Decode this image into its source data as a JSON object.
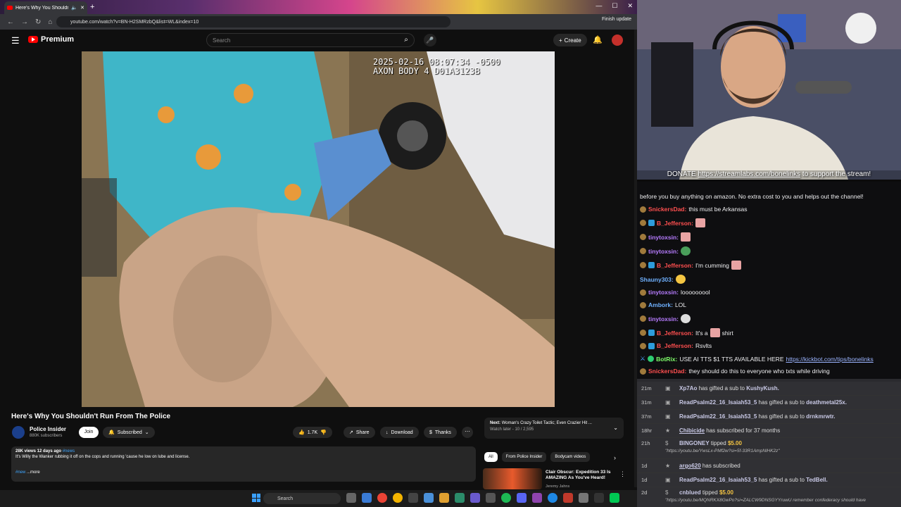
{
  "browser": {
    "tab_title": "Here's Why You Shouldn't",
    "url": "youtube.com/watch?v=BN-H2SMRzbQ&list=WL&index=10",
    "finish_update": "Finish update",
    "new_tab": "+"
  },
  "yt_header": {
    "logo_text": "Premium",
    "search_placeholder": "Search",
    "create_label": "Create"
  },
  "video": {
    "timestamp": "2025-02-16 08:07:34 -0500\nAXON BODY 4 D01A3123B"
  },
  "under_video": {
    "title": "Here's Why You Shouldn't Run From The Police",
    "channel_name": "Police Insider",
    "channel_subs": "880K subscribers",
    "join_label": "Join",
    "subscribed_label": "Subscribed",
    "like_count": "1.7K",
    "share_label": "Share",
    "download_label": "Download",
    "thanks_label": "Thanks",
    "desc_meta": "28K views  12 days ago",
    "desc_hashtag": "#news",
    "desc_text": "It's Willy the Wanker rubbing it off on the cops and running 'cause he low on lube and license.",
    "desc_tag2": "#new",
    "desc_more": "...more"
  },
  "next_card": {
    "label": "Next:",
    "title": "Woman's Crazy Toilet Tactic; Even Crazier Hit ...",
    "sub": "Watch later - 10 / 2,595"
  },
  "chips": [
    "All",
    "From Police Insider",
    "Bodycam videos"
  ],
  "recommend": {
    "title": "Clair Obscur: Expedition 33 Is AMAZING As You've Heard!",
    "channel": "Jeremy Jahns"
  },
  "webcam": {
    "donate_prefix": "DONATE",
    "donate_link": "https://streamlabs.com/bonelinks",
    "donate_suffix": "to support the stream!"
  },
  "chat": [
    {
      "text": "before you buy anything on amazon. No extra cost to you and helps out the channel!"
    },
    {
      "user": "SnickersDad:",
      "text": "this must be Arkansas"
    },
    {
      "user": "B_Jefferson:",
      "text": ""
    },
    {
      "user": "tinytoxsin:",
      "text": ""
    },
    {
      "user": "tinytoxsin:",
      "text": ""
    },
    {
      "user": "B_Jefferson:",
      "text": "I'm cumming"
    },
    {
      "user": "Shauny303:",
      "text": ""
    },
    {
      "user": "tinytoxsin:",
      "text": "looooooool"
    },
    {
      "user": "Ambork:",
      "text": "LOL"
    },
    {
      "user": "tinytoxsin:",
      "text": ""
    },
    {
      "user": "B_Jefferson:",
      "text": "It's a",
      "text2": "shirt"
    },
    {
      "user": "B_Jefferson:",
      "text": "Rsvlts"
    },
    {
      "user": "BotRix:",
      "text": "USE AI TTS $1 TTS AVAILABLE HERE",
      "link": "https://kickbot.com/tips/bonelinks"
    },
    {
      "user": "SnickersDad:",
      "text": "they should do this to everyone who txts while driving"
    }
  ],
  "events": [
    {
      "time": "21m",
      "name": "Xp7Ao",
      "text": "has gifted a sub to",
      "target": "KushyKush."
    },
    {
      "time": "31m",
      "name": "ReadPsalm22_16_Isaiah53_5",
      "text": "has gifted a sub to",
      "target": "deathmetal25x."
    },
    {
      "time": "37m",
      "name": "ReadPsalm22_16_Isaiah53_5",
      "text": "has gifted a sub to",
      "target": "drnkmrwtr."
    },
    {
      "time": "18hr",
      "name": "Chibicide",
      "text": "has subscribed for 37 months",
      "target": ""
    },
    {
      "time": "21h",
      "name": "BINGONEY",
      "text": "tipped",
      "target": "$5.00",
      "sub": "\"https://youtu.be/YwsLx-PMf2w?si=5f-33R1AmpNlHK2z\""
    },
    {
      "time": "1d",
      "name": "argo620",
      "text": "has subscribed",
      "target": ""
    },
    {
      "time": "1d",
      "name": "ReadPsalm22_16_Isaiah53_5",
      "text": "has gifted a sub to",
      "target": "TedBell."
    },
    {
      "time": "2d",
      "name": "cnblued",
      "text": "tipped",
      "target": "$5.00",
      "sub": "\"https://youtu.be/MQNRKX8GwPo?si=ZALCW9DNSGYYruwU remember confederacy should have"
    }
  ],
  "taskbar": {
    "search_label": "Search"
  },
  "colors": {
    "yt_red": "#ff0000",
    "chat_bg": "#0e0e10",
    "events_bg": "#2a2a2e"
  }
}
